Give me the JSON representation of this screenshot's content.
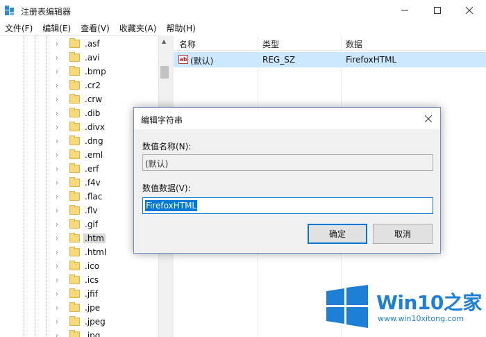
{
  "window": {
    "title": "注册表编辑器",
    "minimize_icon": "minimize-icon",
    "maximize_icon": "maximize-icon",
    "close_icon": "close-icon"
  },
  "menu": [
    "文件(F)",
    "编辑(E)",
    "查看(V)",
    "收藏夹(A)",
    "帮助(H)"
  ],
  "tree": {
    "items": [
      ".asf",
      ".avi",
      ".bmp",
      ".cr2",
      ".crw",
      ".dib",
      ".divx",
      ".dng",
      ".eml",
      ".erf",
      ".f4v",
      ".flac",
      ".flv",
      ".gif",
      ".htm",
      ".html",
      ".ico",
      ".ics",
      ".jfif",
      ".jpe",
      ".jpeg",
      ".jpg"
    ],
    "selected": ".htm"
  },
  "list": {
    "headers": {
      "name": "名称",
      "type": "类型",
      "data": "数据"
    },
    "rows": [
      {
        "name": "(默认)",
        "type": "REG_SZ",
        "data": "FirefoxHTML",
        "icon": "string-value-icon",
        "icon_text": "ab"
      }
    ]
  },
  "dialog": {
    "title": "编辑字符串",
    "name_label": "数值名称(N):",
    "name_value": "(默认)",
    "data_label": "数值数据(V):",
    "data_value": "FirefoxHTML",
    "ok_label": "确定",
    "cancel_label": "取消"
  },
  "watermark": {
    "brand": "Win10",
    "brand_suffix": "之家",
    "url": "www.win10xitong.com",
    "color": "#1e7fd6"
  },
  "colors": {
    "selection": "#cce8ff",
    "accent": "#0078d7",
    "folder": "#f7d97a"
  }
}
